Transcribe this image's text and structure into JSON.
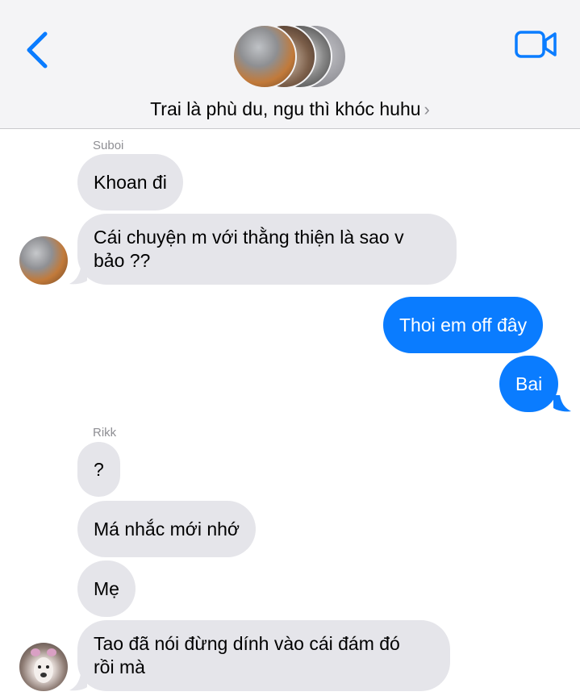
{
  "header": {
    "group_title": "Trai là phù du, ngu thì khóc huhu",
    "chevron": "›",
    "icons": [
      "back-chevron-icon",
      "video-camera-icon"
    ],
    "accent_color": "#0a7cff"
  },
  "messages": {
    "group1": {
      "sender": "Suboi",
      "m1": "Khoan đi",
      "m2_line1": "Cái chuyện m với thằng thiện là sao v",
      "m2_line2": "bảo ??"
    },
    "outgoing": {
      "m1": "Thoi em off đây",
      "m2": "Bai"
    },
    "group2": {
      "sender": "Rikk",
      "m1": "?",
      "m2": "Má nhắc mới nhớ",
      "m3": "Mẹ",
      "m4_line1": "Tao đã nói đừng dính vào cái đám đó",
      "m4_line2": "rồi mà"
    }
  },
  "colors": {
    "incoming_bubble": "#e5e5ea",
    "outgoing_bubble": "#0a7cff",
    "header_bg": "#f4f4f6",
    "meta_text": "#8e8e93"
  }
}
